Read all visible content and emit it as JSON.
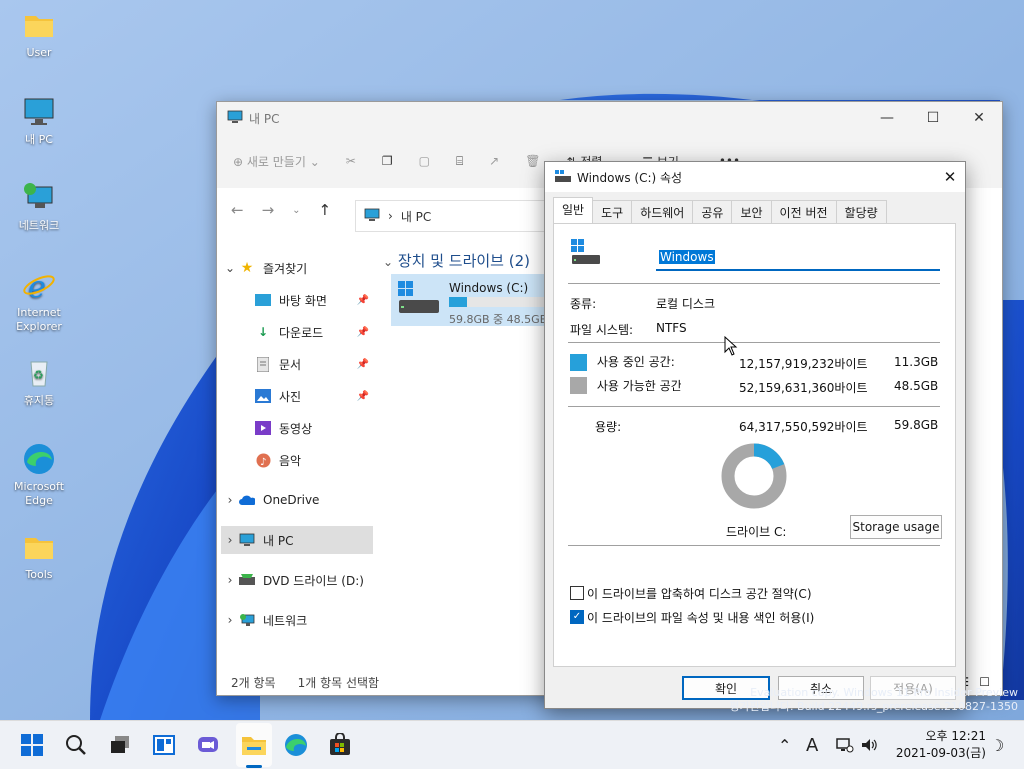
{
  "desktop": {
    "icons": [
      {
        "label": "User"
      },
      {
        "label": "내 PC"
      },
      {
        "label": "네트워크"
      },
      {
        "label": "Internet Explorer"
      },
      {
        "label": "휴지통"
      },
      {
        "label": "Microsoft Edge"
      },
      {
        "label": "Tools"
      }
    ],
    "watermark_line1": "Evaluation copy. Windows 11 Pro Insider Preview",
    "watermark_line2": "평가판입니다. Build 22449.rs_prerelease.210827-1350"
  },
  "explorer": {
    "title": "내 PC",
    "toolbar": {
      "new_label": "새로 만들기",
      "sort_label": "정렬",
      "view_label": "보기",
      "more_label": "•••"
    },
    "address": "내 PC",
    "nav": {
      "quick_access": "즐겨찾기",
      "items": [
        {
          "label": "바탕 화면"
        },
        {
          "label": "다운로드"
        },
        {
          "label": "문서"
        },
        {
          "label": "사진"
        },
        {
          "label": "동영상"
        },
        {
          "label": "음악"
        }
      ],
      "onedrive": "OneDrive",
      "this_pc": "내 PC",
      "dvd": "DVD 드라이브 (D:)",
      "network": "네트워크"
    },
    "group_header": "장치 및 드라이브 (2)",
    "drive": {
      "name": "Windows (C:)",
      "free_text": "59.8GB 중 48.5GB",
      "used_fraction": 0.19
    },
    "status": {
      "count": "2개 항목",
      "selected": "1개 항목 선택함"
    }
  },
  "dialog": {
    "title": "Windows (C:) 속성",
    "tabs": [
      "일반",
      "도구",
      "하드웨어",
      "공유",
      "보안",
      "이전 버전",
      "할당량"
    ],
    "name_value": "Windows",
    "type_label": "종류:",
    "type_value": "로컬 디스크",
    "fs_label": "파일 시스템:",
    "fs_value": "NTFS",
    "used_label": "사용 중인 공간:",
    "used_bytes": "12,157,919,232바이트",
    "used_gb": "11.3GB",
    "free_label": "사용 가능한 공간",
    "free_bytes": "52,159,631,360바이트",
    "free_gb": "48.5GB",
    "cap_label": "용량:",
    "cap_bytes": "64,317,550,592바이트",
    "cap_gb": "59.8GB",
    "used_fraction": 0.19,
    "drive_label": "드라이브 C:",
    "storage_btn": "Storage usage",
    "compress_label": "이 드라이브를 압축하여 디스크 공간 절약(C)",
    "index_label": "이 드라이브의 파일 속성 및 내용 색인 허용(I)",
    "ok": "확인",
    "cancel": "취소",
    "apply": "적용(A)",
    "colors": {
      "used": "#26a0da",
      "free": "#a8a8a8"
    }
  },
  "taskbar": {
    "time": "오후 12:21",
    "date": "2021-09-03(금)",
    "ime": "A"
  }
}
